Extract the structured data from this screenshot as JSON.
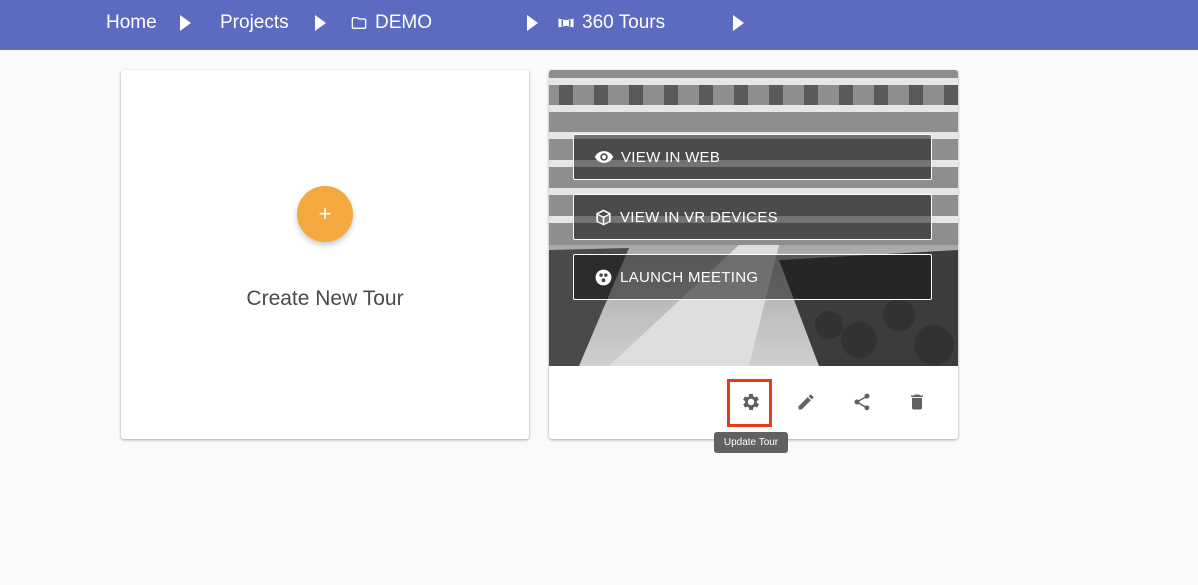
{
  "breadcrumb": {
    "items": [
      {
        "label": "Home"
      },
      {
        "label": "Projects"
      },
      {
        "label": "DEMO",
        "icon": "folder-icon"
      },
      {
        "label": "360 Tours",
        "icon": "panorama-icon"
      }
    ],
    "separator_icon": "arrow-right-icon"
  },
  "create_card": {
    "button_symbol": "+",
    "label": "Create New Tour",
    "accent": "#f4a93f"
  },
  "tour_card": {
    "overlay_buttons": [
      {
        "label": "VIEW IN WEB",
        "icon": "eye-icon"
      },
      {
        "label": "VIEW IN VR DEVICES",
        "icon": "cube-icon"
      },
      {
        "label": "LAUNCH MEETING",
        "icon": "meeting-icon"
      }
    ],
    "actions": [
      {
        "name": "settings",
        "icon": "gear-icon"
      },
      {
        "name": "edit",
        "icon": "pencil-icon"
      },
      {
        "name": "share",
        "icon": "share-icon"
      },
      {
        "name": "delete",
        "icon": "trash-icon"
      }
    ],
    "tooltip": "Update Tour"
  },
  "colors": {
    "topbar": "#5c6bc0",
    "highlight": "#e8391e",
    "tooltip_bg": "#616161"
  }
}
